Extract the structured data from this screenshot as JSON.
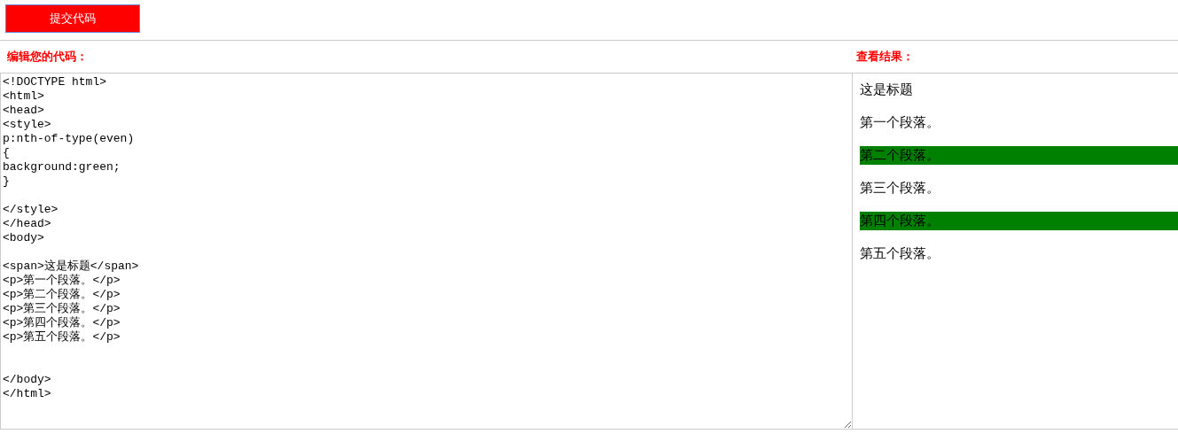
{
  "submit_button": {
    "label": "提交代码"
  },
  "editor": {
    "label": "编辑您的代码：",
    "code": "<!DOCTYPE html>\n<html>\n<head>\n<style>\np:nth-of-type(even)\n{\nbackground:green;\n}\n\n</style>\n</head>\n<body>\n\n<span>这是标题</span>\n<p>第一个段落。</p>\n<p>第二个段落。</p>\n<p>第三个段落。</p>\n<p>第四个段落。</p>\n<p>第五个段落。</p>\n\n\n</body>\n</html>"
  },
  "result": {
    "label": "查看结果：",
    "heading": "这是标题",
    "paragraphs": [
      {
        "text": "第一个段落。",
        "highlighted": false
      },
      {
        "text": "第二个段落。",
        "highlighted": true
      },
      {
        "text": "第三个段落。",
        "highlighted": false
      },
      {
        "text": "第四个段落。",
        "highlighted": true
      },
      {
        "text": "第五个段落。",
        "highlighted": false
      }
    ]
  }
}
